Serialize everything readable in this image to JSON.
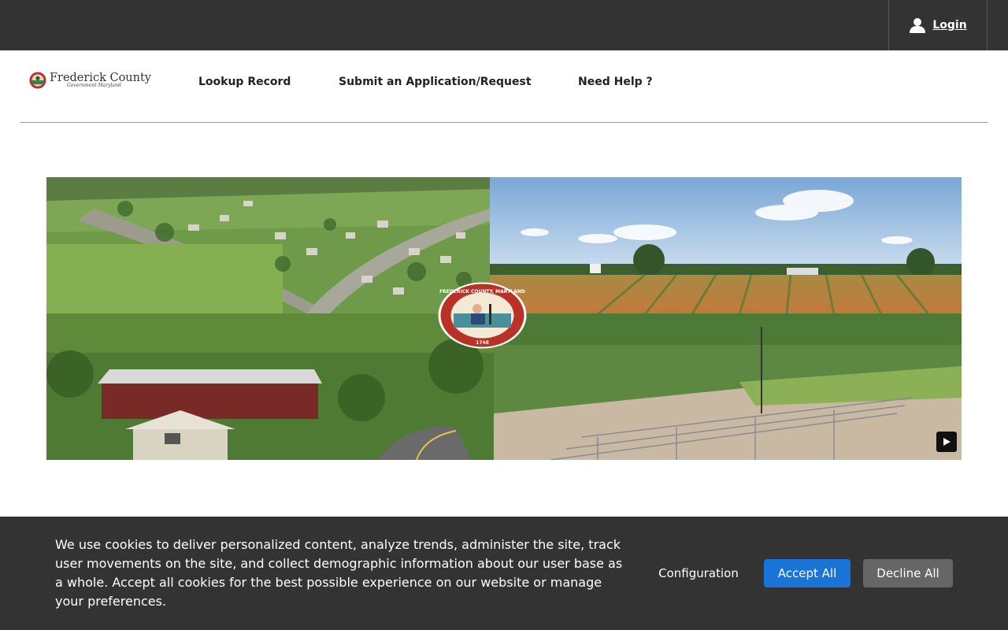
{
  "topbar": {
    "login_label": "Login",
    "login_icon": "user-icon"
  },
  "header": {
    "logo": {
      "title": "Frederick County",
      "sub": "Government",
      "script": "Maryland"
    },
    "nav": [
      {
        "label": "Lookup Record"
      },
      {
        "label": "Submit an Application/Request"
      },
      {
        "label": "Need Help ?"
      }
    ]
  },
  "hero": {
    "seal": {
      "text": "FREDERICK COUNTY, MARYLAND",
      "year": "1748"
    },
    "play_icon": "play-icon"
  },
  "cookie_banner": {
    "message": "We use cookies to deliver personalized content, analyze trends, administer the site, track user movements on the site, and collect demographic information about our user base as a whole. Accept all cookies for the best possible experience on our website or manage your preferences.",
    "config_label": "Configuration",
    "accept_label": "Accept All",
    "decline_label": "Decline All"
  },
  "colors": {
    "topbar": "#333333",
    "accept": "#1a73d6",
    "decline": "#666666"
  }
}
